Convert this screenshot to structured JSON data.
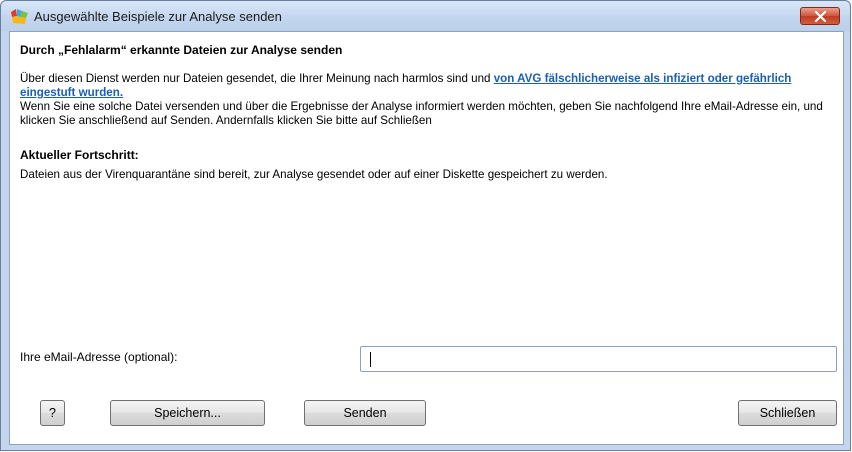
{
  "window": {
    "title": "Ausgewählte Beispiele zur Analyse senden"
  },
  "content": {
    "heading": "Durch „Fehlalarm“ erkannte Dateien zur Analyse senden",
    "para_before_link": "Über diesen Dienst werden nur Dateien gesendet, die Ihrer Meinung nach harmlos sind und ",
    "link_text": "von AVG fälschlicherweise als infiziert oder gefährlich eingestuft wurden.",
    "para_after_link": " Wenn Sie eine solche Datei versenden und über die Ergebnisse der Analyse informiert werden möchten, geben Sie nachfolgend Ihre eMail-Adresse ein, und klicken Sie anschließend auf Senden. Andernfalls klicken Sie bitte auf Schließen",
    "progress_label": "Aktueller Fortschritt:",
    "progress_text": "Dateien aus der Virenquarantäne sind bereit, zur Analyse gesendet oder auf einer Diskette gespeichert zu werden."
  },
  "email": {
    "label": "Ihre eMail-Adresse (optional):",
    "value": ""
  },
  "buttons": {
    "help": "?",
    "save": "Speichern...",
    "send": "Senden",
    "close": "Schließen"
  },
  "icons": {
    "app": "avg-logo-icon",
    "close": "close-icon"
  },
  "colors": {
    "link": "#1a5fb4",
    "close_button": "#c8452a"
  }
}
